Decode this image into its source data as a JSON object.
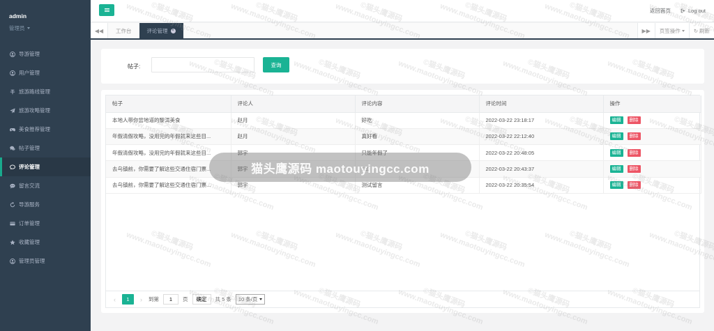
{
  "sidebar": {
    "username": "admin",
    "role": "管理员",
    "items": [
      {
        "label": "导游管理",
        "icon": "user-circle-icon"
      },
      {
        "label": "用户管理",
        "icon": "user-circle-icon"
      },
      {
        "label": "旅游路线管理",
        "icon": "strikethrough-icon"
      },
      {
        "label": "旅游攻略管理",
        "icon": "paper-plane-icon"
      },
      {
        "label": "美食推荐管理",
        "icon": "gamepad-icon"
      },
      {
        "label": "帖子管理",
        "icon": "comments-icon"
      },
      {
        "label": "评论管理",
        "icon": "comment-icon",
        "active": true
      },
      {
        "label": "留言交流",
        "icon": "comment-dots-icon"
      },
      {
        "label": "导游服务",
        "icon": "refresh-icon"
      },
      {
        "label": "订单管理",
        "icon": "credit-card-icon"
      },
      {
        "label": "收藏管理",
        "icon": "star-icon"
      },
      {
        "label": "管理员管理",
        "icon": "user-circle-icon"
      }
    ]
  },
  "topbar": {
    "home_link": "返回首页",
    "logout": "Log out"
  },
  "tabbar": {
    "tabs": [
      {
        "label": "工作台",
        "active": false
      },
      {
        "label": "评论管理",
        "active": true
      }
    ],
    "page_ops": "页签操作",
    "refresh": "刷新"
  },
  "search": {
    "label": "帖子:",
    "value": "",
    "placeholder": "",
    "button": "查询"
  },
  "table": {
    "headers": [
      "帖子",
      "评论人",
      "评论内容",
      "评论时间",
      "操作"
    ],
    "rows": [
      {
        "post": "本地人带你尝地道的黎洱美食",
        "commenter": "赵月",
        "content": "好吃",
        "time": "2022-03-22 23:18:17"
      },
      {
        "post": "年假清假攻略，没用完的年假就来这些目...",
        "commenter": "赵月",
        "content": "真好看",
        "time": "2022-03-22 22:12:40"
      },
      {
        "post": "年假清假攻略，没用完的年假就来这些目...",
        "commenter": "郭宇",
        "content": "只能年假了",
        "time": "2022-03-22 20:48:05"
      },
      {
        "post": "去乌镇前，你需要了解这些交通住宿门票...",
        "commenter": "郭宇",
        "content": "123",
        "time": "2022-03-22 20:43:37"
      },
      {
        "post": "去乌镇前，你需要了解这些交通住宿门票...",
        "commenter": "郭宇",
        "content": "测试留言",
        "time": "2022-03-22 20:35:54"
      }
    ],
    "edit_label": "编辑",
    "delete_label": "删除"
  },
  "pager": {
    "current": "1",
    "goto_label": "到第",
    "goto_value": "1",
    "page_unit": "页",
    "confirm": "确定",
    "total": "共 5 条",
    "page_size": "10 条/页"
  },
  "watermark": {
    "band_text": "猫头鹰源码 maotouyingcc.com",
    "tile_line1": "©猫头鹰源码",
    "tile_line2": "www.maotouyingcc.com"
  },
  "colors": {
    "sidebar_bg": "#2f4050",
    "accent": "#1ab394",
    "danger": "#ed5565"
  }
}
